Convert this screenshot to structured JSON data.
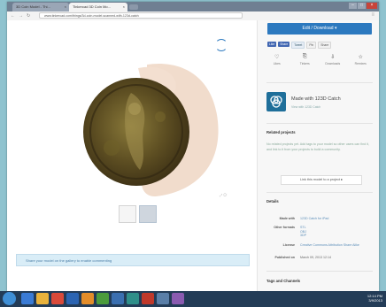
{
  "browser": {
    "tabs": [
      {
        "label": "3D Coin Model - Thi...",
        "close": "×"
      },
      {
        "label": "Tinkercad 3D Coin Mo...",
        "close": "×"
      }
    ],
    "url": "www.tinkercad.com/things/3d-coin-model-scanned-with-123d-catch",
    "window_controls": {
      "minimize": "–",
      "maximize": "□",
      "close": "×"
    }
  },
  "viewer": {
    "view_controls": "⤢ ⟳"
  },
  "notice": {
    "text": "Share your model on the gallery to enable commenting"
  },
  "sidebar": {
    "edit_button": "Edit / Download ▾",
    "social": [
      "Like",
      "Share",
      "Tweet",
      "Pin",
      "Share"
    ],
    "stats": [
      {
        "icon": "♡",
        "label": "Likes"
      },
      {
        "icon": "⎘",
        "label": "Tinkers"
      },
      {
        "icon": "⇩",
        "label": "Downloads"
      },
      {
        "icon": "☆",
        "label": "Remixes"
      }
    ],
    "made_with": {
      "title": "Made with 123D Catch",
      "subtitle": "View with 123D Catch"
    },
    "related": {
      "title": "Related projects",
      "text": "No related projects yet. Add tags to your model so other users can find it, and link to it from your projects to build a community.",
      "button": "Link this model to a project ▸"
    },
    "details": {
      "title": "Details",
      "rows": [
        {
          "key": "Made with",
          "value": "123D Catch for iPad"
        },
        {
          "key": "Other formats",
          "value": "STL\nOBJ\n3DP"
        },
        {
          "key": "License",
          "value": "Creative Commons Attribution Share Alike"
        },
        {
          "key": "Published on",
          "value": "March 09, 2013 12:14"
        }
      ]
    },
    "tags_title": "Tags and Channels"
  },
  "taskbar": {
    "tray_time": "12:14 PM",
    "tray_date": "3/9/2013"
  },
  "colors": {
    "accent": "#2c79bf",
    "notice_bg": "#d9edf7",
    "taskbar": "#233c57"
  }
}
